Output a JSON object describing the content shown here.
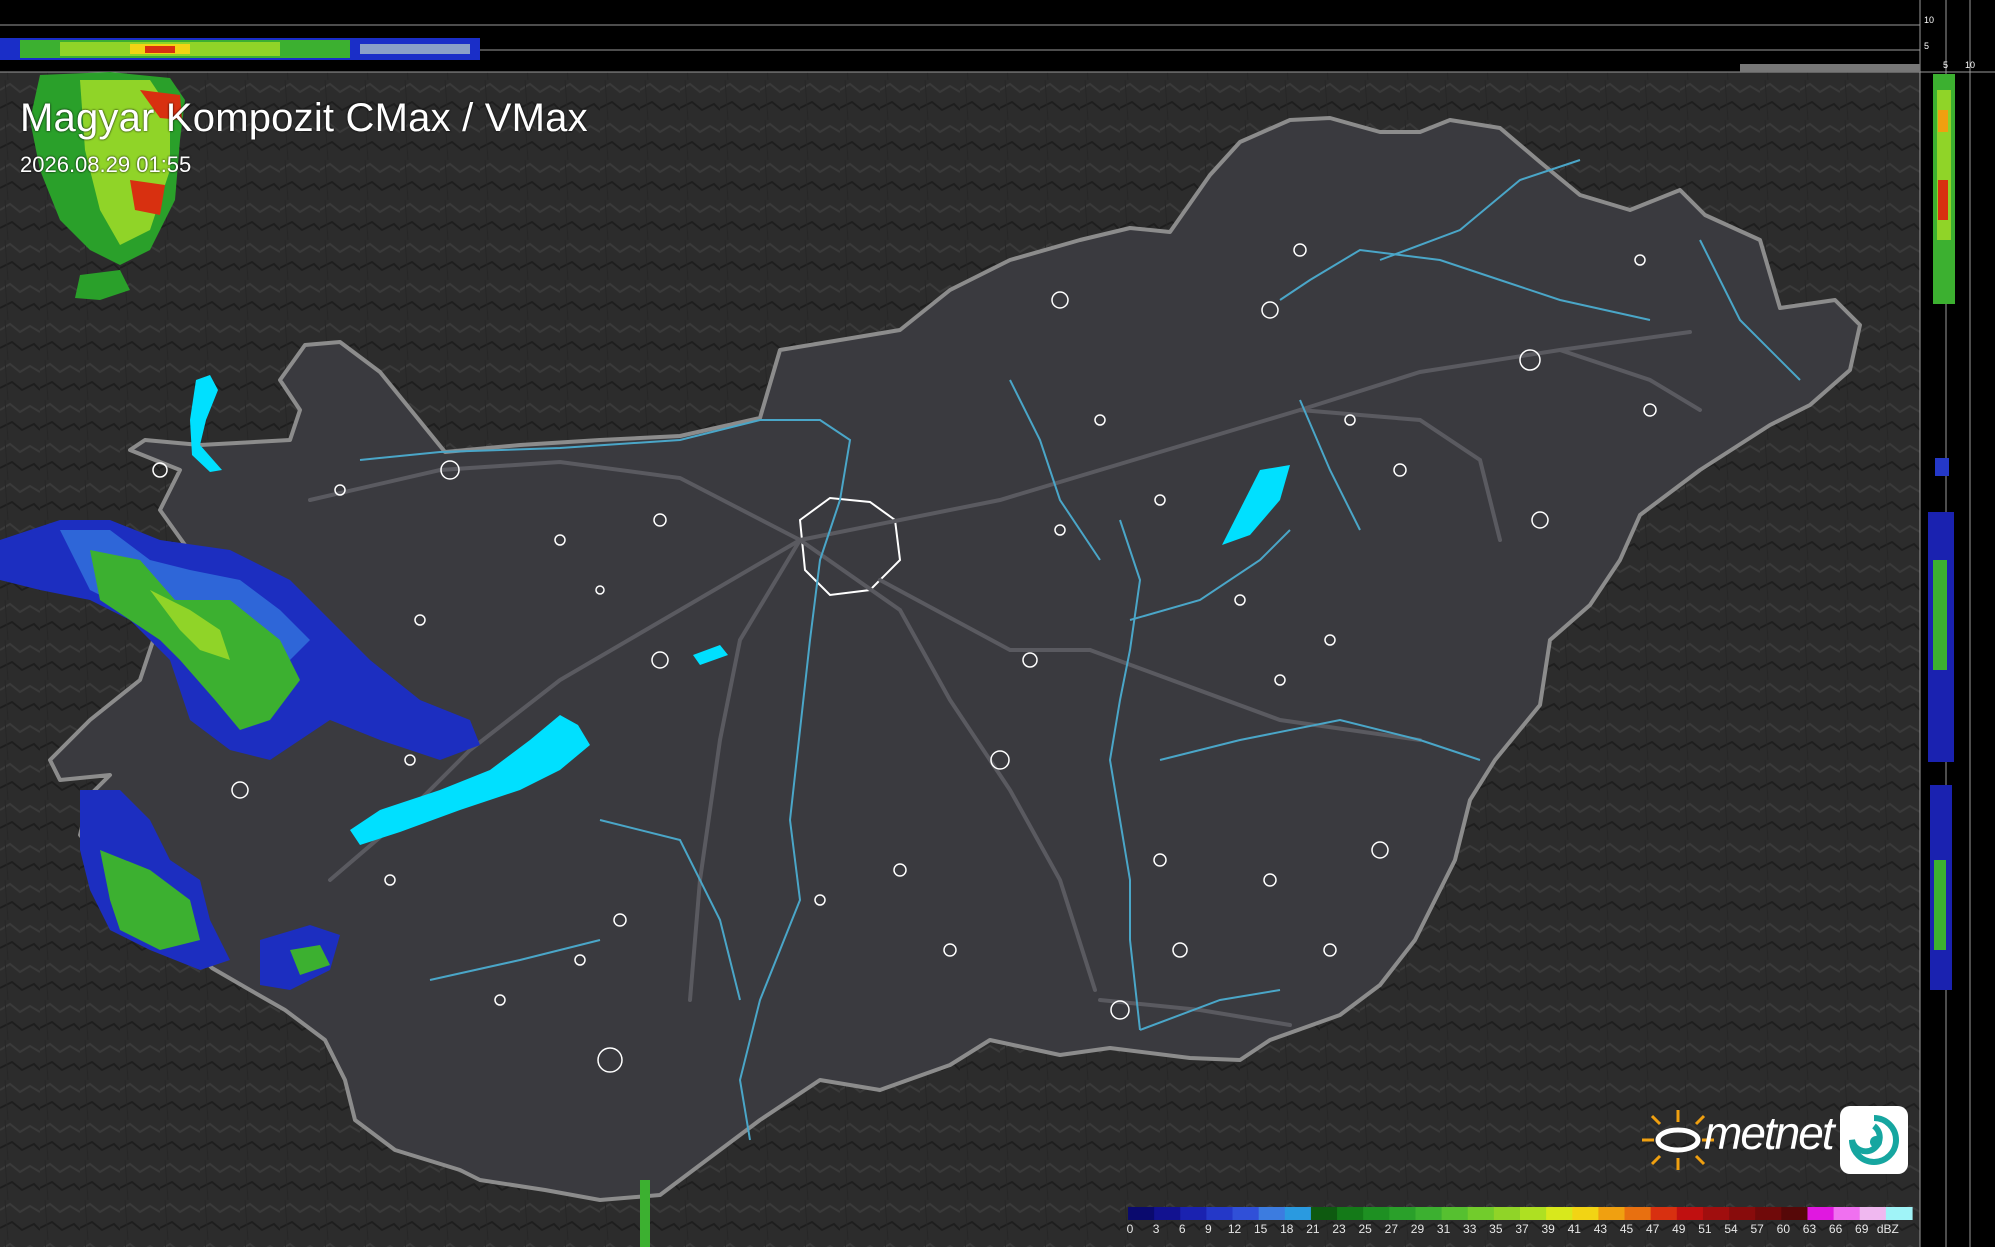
{
  "map": {
    "title": "Magyar Kompozit CMax / VMax",
    "timestamp": "2026.08.29 01:55",
    "brand": "metnet"
  },
  "profile_axes": {
    "top_ticks": [
      "10",
      "5"
    ],
    "side_ticks": [
      "5",
      "10"
    ]
  },
  "color_scale": {
    "unit": "dBZ",
    "labels": [
      "0",
      "3",
      "6",
      "9",
      "12",
      "15",
      "18",
      "21",
      "23",
      "25",
      "27",
      "29",
      "31",
      "33",
      "35",
      "37",
      "39",
      "41",
      "43",
      "45",
      "47",
      "49",
      "51",
      "54",
      "57",
      "60",
      "63",
      "66",
      "69"
    ],
    "colors": [
      "#0a0a6e",
      "#121290",
      "#1a22b0",
      "#2438c8",
      "#3050d8",
      "#3c7ce0",
      "#2a9ae0",
      "#0e5a10",
      "#147a18",
      "#1e9022",
      "#2aa02a",
      "#3cb030",
      "#56c030",
      "#72cc2c",
      "#90d428",
      "#aee022",
      "#d8e81c",
      "#f2d414",
      "#f0a010",
      "#e87010",
      "#d83010",
      "#c01010",
      "#a00e0e",
      "#880c0c",
      "#700a0a",
      "#560808",
      "#e018e0",
      "#f070f0",
      "#f0b8f0",
      "#a0f4f8"
    ]
  },
  "icons": [
    "metnet-sun-logo-icon",
    "metnet-swirl-icon"
  ]
}
